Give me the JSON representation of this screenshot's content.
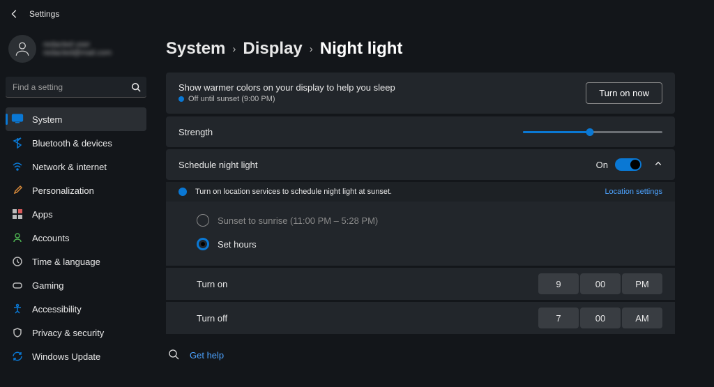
{
  "header": {
    "title": "Settings"
  },
  "user": {
    "name": "redacted user",
    "email": "redacted@mail.com"
  },
  "search": {
    "placeholder": "Find a setting"
  },
  "sidebar": {
    "items": [
      {
        "label": "System",
        "icon": "monitor",
        "active": true
      },
      {
        "label": "Bluetooth & devices",
        "icon": "bluetooth"
      },
      {
        "label": "Network & internet",
        "icon": "wifi"
      },
      {
        "label": "Personalization",
        "icon": "brush"
      },
      {
        "label": "Apps",
        "icon": "grid"
      },
      {
        "label": "Accounts",
        "icon": "person"
      },
      {
        "label": "Time & language",
        "icon": "clock"
      },
      {
        "label": "Gaming",
        "icon": "gamepad"
      },
      {
        "label": "Accessibility",
        "icon": "access"
      },
      {
        "label": "Privacy & security",
        "icon": "shield"
      },
      {
        "label": "Windows Update",
        "icon": "update"
      }
    ]
  },
  "breadcrumb": {
    "a": "System",
    "b": "Display",
    "c": "Night light"
  },
  "turnon_card": {
    "desc": "Show warmer colors on your display to help you sleep",
    "status": "Off until sunset (9:00 PM)",
    "button": "Turn on now"
  },
  "strength": {
    "label": "Strength",
    "value_pct": 48
  },
  "schedule": {
    "label": "Schedule night light",
    "state": "On"
  },
  "notice": {
    "msg": "Turn on location services to schedule night light at sunset.",
    "link": "Location settings"
  },
  "radios": {
    "sunset": "Sunset to sunrise (11:00 PM – 5:28 PM)",
    "sethours": "Set hours",
    "selected": "sethours"
  },
  "turn_on_time": {
    "label": "Turn on",
    "h": "9",
    "m": "00",
    "ampm": "PM"
  },
  "turn_off_time": {
    "label": "Turn off",
    "h": "7",
    "m": "00",
    "ampm": "AM"
  },
  "help": {
    "label": "Get help"
  }
}
